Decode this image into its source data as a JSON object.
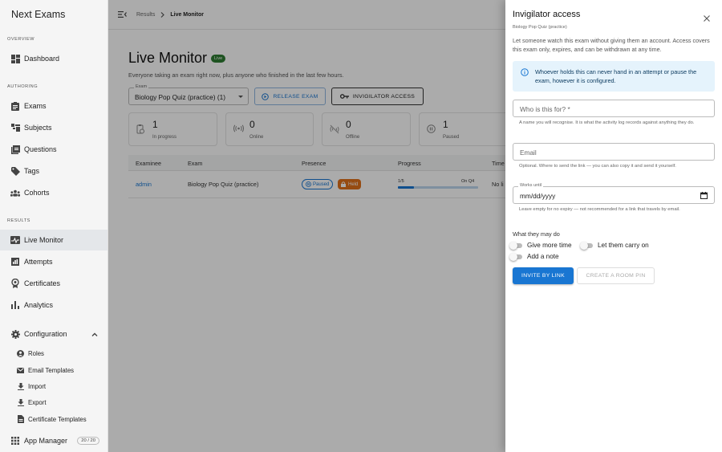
{
  "sidebar": {
    "brand": "Next Exams",
    "sections": {
      "overview": "OVERVIEW",
      "authoring": "AUTHORING",
      "results": "RESULTS"
    },
    "items": [
      {
        "label": "Dashboard",
        "icon": "dashboard-icon"
      },
      {
        "label": "Exams",
        "icon": "exams-icon"
      },
      {
        "label": "Subjects",
        "icon": "subjects-icon"
      },
      {
        "label": "Questions",
        "icon": "questions-icon"
      },
      {
        "label": "Tags",
        "icon": "tag-icon"
      },
      {
        "label": "Cohorts",
        "icon": "cohorts-icon"
      },
      {
        "label": "Live Monitor",
        "icon": "live-monitor-icon",
        "active": true
      },
      {
        "label": "Attempts",
        "icon": "attempts-icon"
      },
      {
        "label": "Certificates",
        "icon": "certificate-icon"
      },
      {
        "label": "Analytics",
        "icon": "analytics-icon"
      },
      {
        "label": "Configuration",
        "icon": "gear-icon"
      }
    ],
    "config_items": [
      {
        "label": "Roles",
        "icon": "roles-icon"
      },
      {
        "label": "Email Templates",
        "icon": "email-icon"
      },
      {
        "label": "Import",
        "icon": "import-icon"
      },
      {
        "label": "Export",
        "icon": "export-icon"
      },
      {
        "label": "Certificate Templates",
        "icon": "certificate-template-icon"
      }
    ],
    "app_manager": {
      "label": "App Manager",
      "badge": "20 / 20",
      "icon": "grid-icon"
    }
  },
  "topbar": {
    "breadcrumb_parent": "Results",
    "breadcrumb_current": "Live Monitor"
  },
  "page": {
    "title": "Live Monitor",
    "live_badge": "Live",
    "description": "Everyone taking an exam right now, plus anyone who finished in the last few hours.",
    "exam_select": {
      "label": "Exam",
      "value": "Biology Pop Quiz (practice) (1)"
    },
    "release_button": "RELEASE EXAM",
    "invigilator_button": "INVIGILATOR ACCESS",
    "stats": [
      {
        "value": "1",
        "label": "In progress"
      },
      {
        "value": "0",
        "label": "Online"
      },
      {
        "value": "0",
        "label": "Offline"
      },
      {
        "value": "1",
        "label": "Paused"
      }
    ],
    "table": {
      "headers": [
        "Examinee",
        "Exam",
        "Presence",
        "Progress",
        "Time"
      ],
      "rows": [
        {
          "examinee": "admin",
          "exam": "Biology Pop Quiz (practice)",
          "presence": "Paused",
          "held": "Held",
          "progress": "1/5",
          "progress_value": 0.2,
          "progress_note": "On Q4",
          "time": "No li"
        }
      ]
    }
  },
  "drawer": {
    "title": "Invigilator access",
    "subtitle": "Biology Pop Quiz (practice)",
    "intro": "Let someone watch this exam without giving them an account. Access covers this exam only, expires, and can be withdrawn at any time.",
    "info": "Whoever holds this can never hand in an attempt or pause the exam, however it is configured.",
    "who_placeholder": "Who is this for? *",
    "who_help": "A name you will recognise. It is what the activity log records against anything they do.",
    "email_placeholder": "Email",
    "email_help": "Optional. Where to send the link — you can also copy it and send it yourself.",
    "works_until_label": "Works until",
    "works_until_placeholder": "mm/dd/yyyy",
    "works_until_help": "Leave empty for no expiry — not recommended for a link that travels by email.",
    "permissions_title": "What they may do",
    "permissions": [
      "Give more time",
      "Let them carry on",
      "Add a note"
    ],
    "invite_button": "INVITE BY LINK",
    "room_pin_button": "CREATE A ROOM PIN"
  },
  "colors": {
    "primary": "#1976d2",
    "live_green": "#2e7d32",
    "held_orange": "#e0701a",
    "info_bg": "#e5f3fc"
  }
}
